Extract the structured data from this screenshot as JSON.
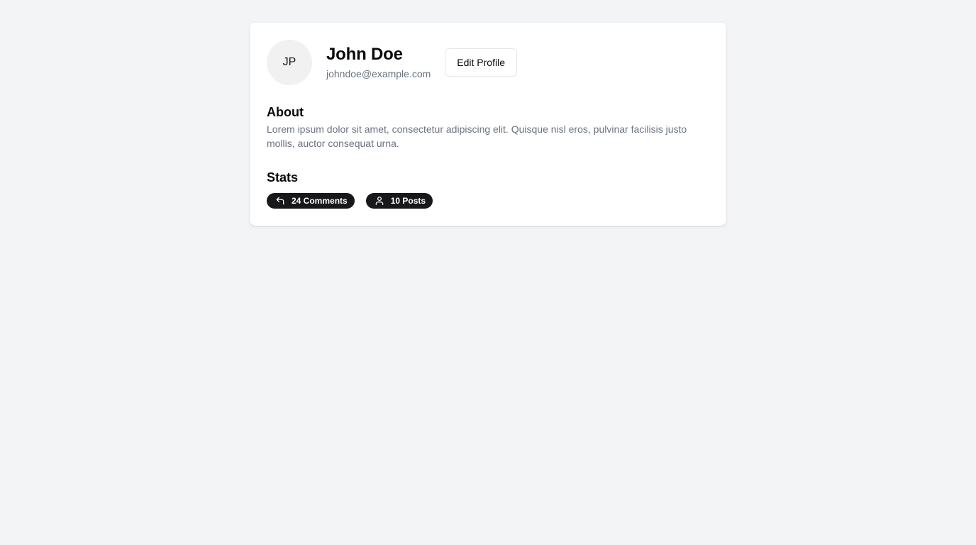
{
  "profile": {
    "avatar_initials": "JP",
    "name": "John Doe",
    "email": "johndoe@example.com",
    "edit_label": "Edit Profile"
  },
  "about": {
    "title": "About",
    "text": "Lorem ipsum dolor sit amet, consectetur adipiscing elit. Quisque nisl eros, pulvinar facilisis justo mollis, auctor consequat urna."
  },
  "stats": {
    "title": "Stats",
    "comments": {
      "label": "24 Comments",
      "icon": "reply-icon"
    },
    "posts": {
      "label": "10 Posts",
      "icon": "user-icon"
    }
  },
  "colors": {
    "page_background": "#f3f4f6",
    "card_background": "#ffffff",
    "muted_text": "#6b7280",
    "badge_background": "#18181b"
  }
}
